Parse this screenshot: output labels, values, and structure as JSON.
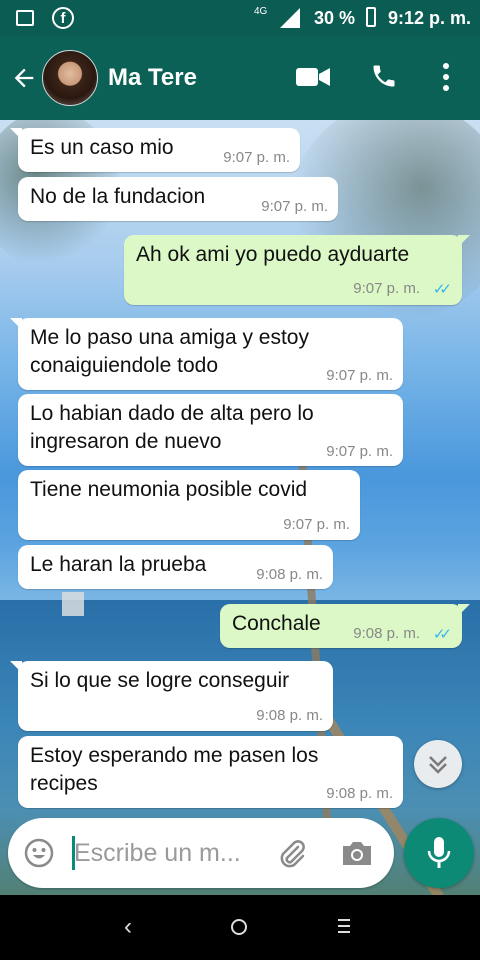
{
  "status_bar": {
    "network": "4G",
    "battery": "30 %",
    "time": "9:12 p. m."
  },
  "header": {
    "contact_name": "Ma Tere"
  },
  "messages": [
    {
      "dir": "in",
      "text": "Es un caso mio",
      "time": "9:07 p. m."
    },
    {
      "dir": "in",
      "text": "No de la fundacion",
      "time": "9:07 p. m."
    },
    {
      "dir": "out",
      "text": "Ah ok ami yo puedo ayduarte",
      "time": "9:07 p. m.",
      "status": "read"
    },
    {
      "dir": "in",
      "text": "Me lo paso una amiga y estoy\nconaiguiendole todo",
      "time": "9:07 p. m."
    },
    {
      "dir": "in",
      "text": "Lo habian dado de alta pero lo\ningresaron de nuevo",
      "time": "9:07 p. m."
    },
    {
      "dir": "in",
      "text": "Tiene neumonia posible covid",
      "time": "9:07 p. m."
    },
    {
      "dir": "in",
      "text": "Le haran la prueba",
      "time": "9:08 p. m."
    },
    {
      "dir": "out",
      "text": "Conchale",
      "time": "9:08 p. m.",
      "status": "read"
    },
    {
      "dir": "in",
      "text": "Si lo que se logre conseguir",
      "time": "9:08 p. m."
    },
    {
      "dir": "in",
      "text": "Estoy esperando me pasen los\nrecipes",
      "time": "9:08 p. m."
    }
  ],
  "input": {
    "placeholder": "Escribe un m..."
  },
  "icons": {
    "read_receipt": "double-check-icon",
    "receipt_color": "#34b7f1"
  },
  "colors": {
    "header": "#0b6156",
    "status_bar": "#0b5c52",
    "outgoing_bubble": "#dcf8c6",
    "incoming_bubble": "#ffffff",
    "mic_button": "#0d8a76"
  }
}
